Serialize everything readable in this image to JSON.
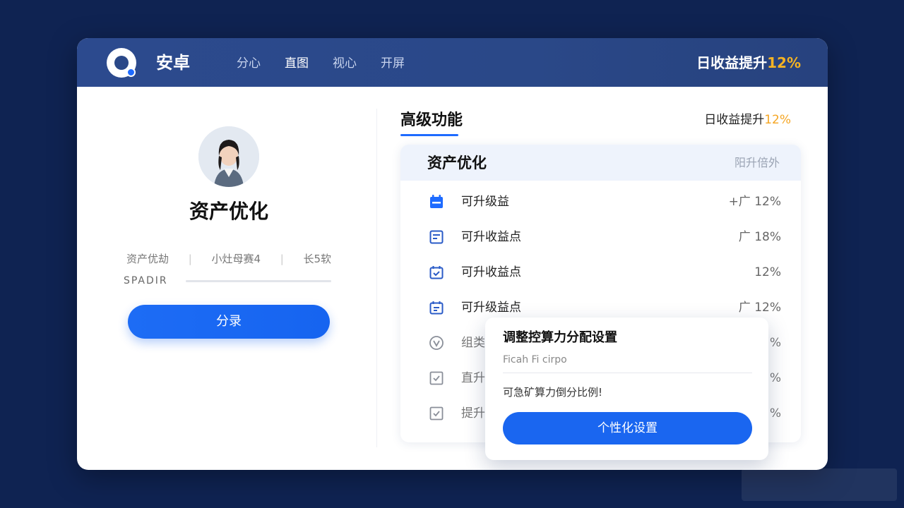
{
  "header": {
    "brand": "安卓",
    "nav": [
      "分心",
      "直图",
      "视心",
      "开屏"
    ],
    "gain_text": "日收益提升",
    "gain_pct": "12%"
  },
  "profile": {
    "name": "资产优化",
    "stats": [
      "资产优劫",
      "小灶母赛4",
      "长5软"
    ],
    "progress_label": "SPADIR",
    "progress": 0.0,
    "button_label": "分录"
  },
  "features": {
    "title": "高级功能",
    "gain_text": "日收益提升",
    "gain_pct": "12%",
    "list_title": "资产优化",
    "list_head_right": "阳升倍外",
    "rows": [
      {
        "icon": "calendar-icon",
        "label": "可升级益",
        "value": "+广 12%"
      },
      {
        "icon": "document-icon",
        "label": "可升收益点",
        "value": "广 18%"
      },
      {
        "icon": "calendar-check-icon",
        "label": "可升收益点",
        "value": "12%"
      },
      {
        "icon": "calendar-edit-icon",
        "label": "可升级益点",
        "value": "广 12%"
      },
      {
        "icon": "shield-icon",
        "label": "组类",
        "value": "%"
      },
      {
        "icon": "checkbox-icon",
        "label": "直升",
        "value": "%"
      },
      {
        "icon": "checkbox-icon",
        "label": "提升",
        "value": "%"
      }
    ]
  },
  "popup": {
    "title": "调整控算力分配设置",
    "subtitle": "Ficah Fi cirpo",
    "desc": "可急矿算力倒分比例!",
    "button_label": "个性化设置"
  },
  "colors": {
    "header_bg": "#2a4888",
    "page_bg": "#0f2352",
    "accent": "#1a66f0",
    "highlight": "#f5b323"
  }
}
